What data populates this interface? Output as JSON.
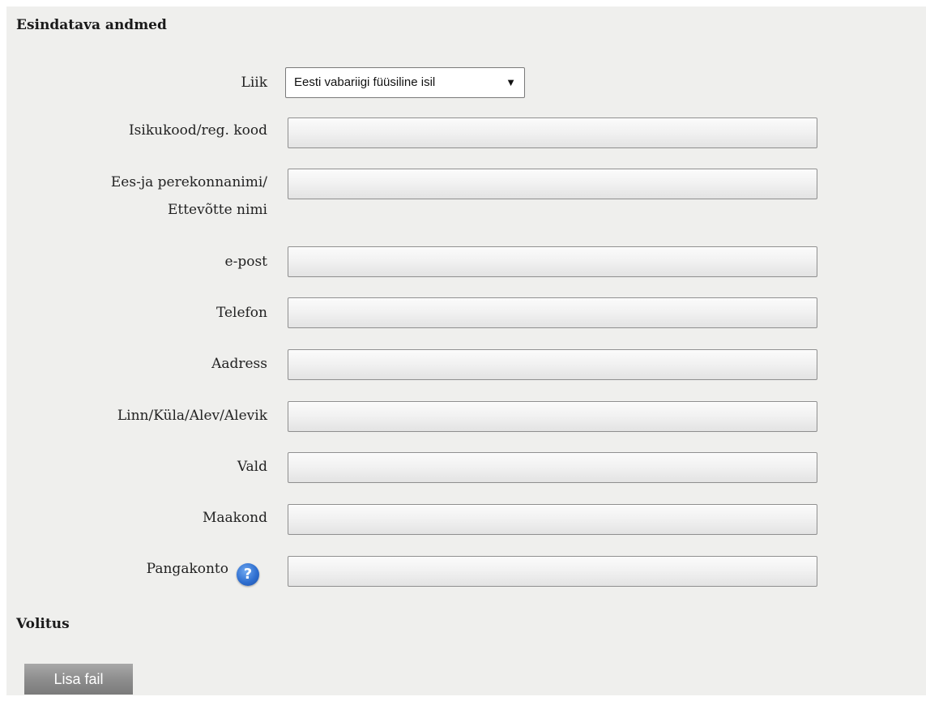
{
  "sections": {
    "representative_title": "Esindatava andmed",
    "authorization_title": "Volitus"
  },
  "fields": {
    "type": {
      "label": "Liik",
      "selected": "Eesti vabariigi füüsiline isil",
      "arrow_icon": "triangle-down-icon"
    },
    "id_code": {
      "label": "Isikukood/reg. kood",
      "value": ""
    },
    "name": {
      "label_line1": "Ees-ja perekonnanimi/",
      "label_line2": "Ettevõtte nimi",
      "value": ""
    },
    "email": {
      "label": "e-post",
      "value": ""
    },
    "phone": {
      "label": "Telefon",
      "value": ""
    },
    "address": {
      "label": "Aadress",
      "value": ""
    },
    "city": {
      "label": "Linn/Küla/Alev/Alevik",
      "value": ""
    },
    "municipality": {
      "label": "Vald",
      "value": ""
    },
    "county": {
      "label": "Maakond",
      "value": ""
    },
    "bank_account": {
      "label": "Pangakonto",
      "value": "",
      "help_icon": "question-mark-icon",
      "help_glyph": "?"
    }
  },
  "buttons": {
    "add_file": "Lisa fail"
  },
  "colors": {
    "panel_background": "#efefed",
    "help_icon": "#2f6fd0",
    "button_background": "#8e8e8e"
  }
}
